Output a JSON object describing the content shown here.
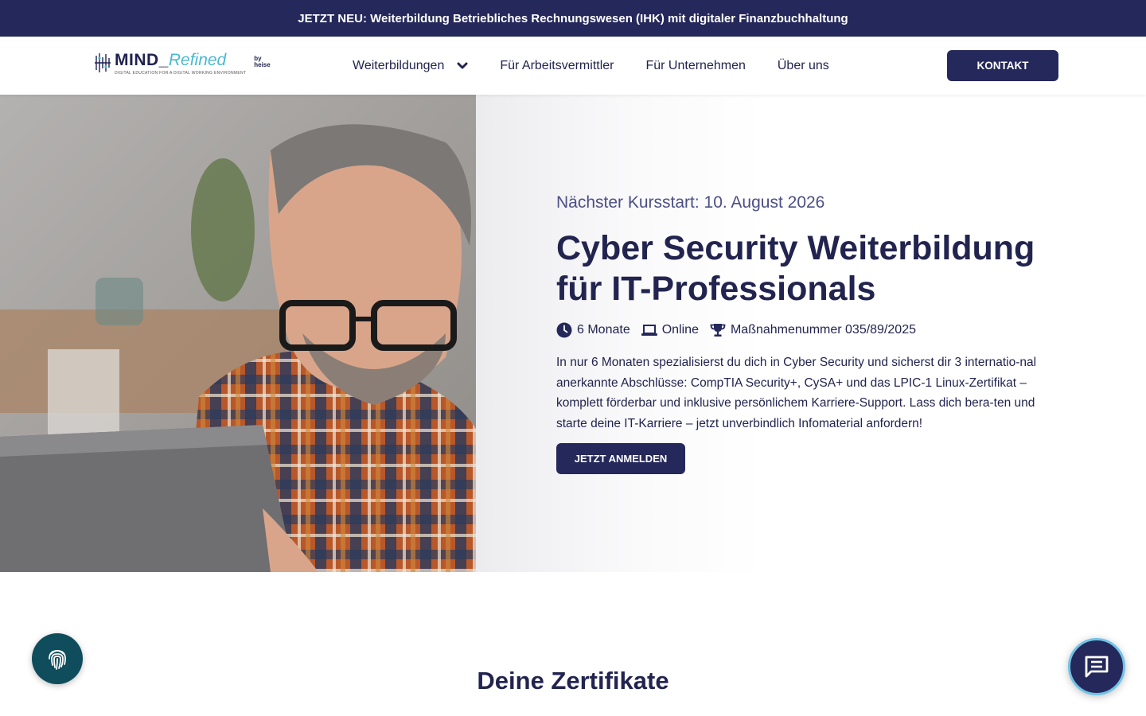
{
  "announcement": {
    "text": "JETZT NEU: Weiterbildung Betriebliches Rechnungswesen (IHK) mit digitaler Finanzbuchhaltung"
  },
  "logo": {
    "main": "MIND_",
    "accent": "Refined",
    "by": "by heise",
    "tagline": "DIGITAL EDUCATION FOR A DIGITAL WORKING ENVIRONMENT"
  },
  "nav": {
    "items": [
      {
        "label": "Weiterbildungen",
        "has_dropdown": true
      },
      {
        "label": "Für Arbeitsvermittler"
      },
      {
        "label": "Für Unternehmen"
      },
      {
        "label": "Über uns"
      }
    ],
    "contact_label": "KONTAKT"
  },
  "hero": {
    "next_start": "Nächster Kursstart: 10. August 2026",
    "title_line1": "Cyber Security Weiterbildung",
    "title_line2": "für IT-Professionals",
    "meta": {
      "duration": "6 Monate",
      "format": "Online",
      "measure": "Maßnahmenummer 035/89/2025"
    },
    "description": "In nur 6 Monaten spezialisierst du dich in Cyber Security und sicherst dir 3 internatio-nal anerkannte Abschlüsse: CompTIA Security+, CySA+ und das LPIC-1 Linux-Zertifikat – komplett förderbar und inklusive persönlichem Karriere-Support. Lass dich bera-ten und starte deine IT-Karriere – jetzt unverbindlich Infomaterial anfordern!",
    "cta_label": "JETZT ANMELDEN"
  },
  "section": {
    "title": "Deine Zertifikate"
  },
  "colors": {
    "primary": "#25285a",
    "accent": "#4cb8d0",
    "fingerprint_bg": "#0f4c5c",
    "chat_ring": "#6fc3e6"
  },
  "icons": [
    "clock-icon",
    "laptop-icon",
    "trophy-icon",
    "chevron-down-icon",
    "fingerprint-icon",
    "chat-icon"
  ]
}
